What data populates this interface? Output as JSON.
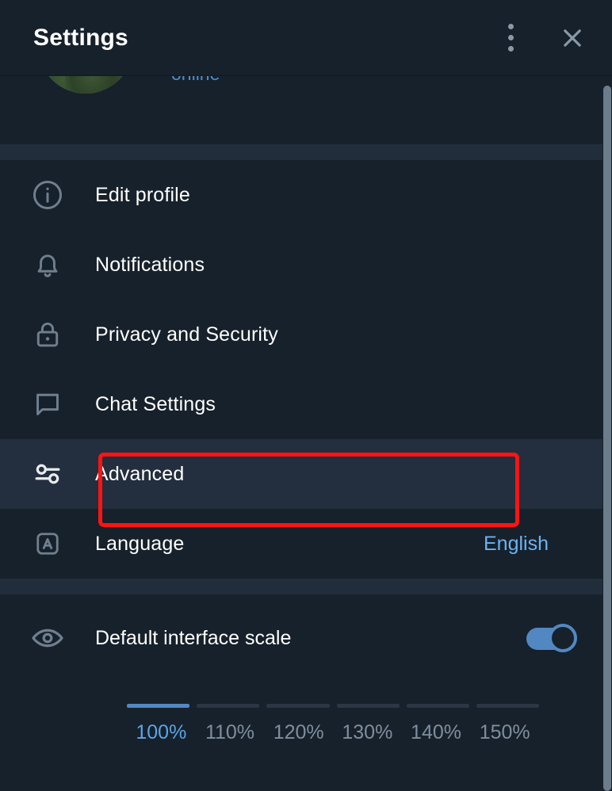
{
  "window": {
    "title": "Settings",
    "menu_icon": "more-vertical-icon",
    "close_icon": "close-icon"
  },
  "colors": {
    "background": "#17212b",
    "row_hover": "#232e3e",
    "divider": "#222d3c",
    "accent": "#5288c1",
    "link": "#6ab3f3",
    "highlight_box": "#ff1414",
    "icon": "#707f8f",
    "text": "#ffffff",
    "muted_text": "#7f8e9e"
  },
  "profile": {
    "avatar_icon": "user-avatar-photo",
    "name": "",
    "status": "online"
  },
  "menu": {
    "items": [
      {
        "label": "Edit profile",
        "icon": "info-circle-icon",
        "value": "",
        "hover": false
      },
      {
        "label": "Notifications",
        "icon": "bell-icon",
        "value": "",
        "hover": false
      },
      {
        "label": "Privacy and Security",
        "icon": "lock-icon",
        "value": "",
        "hover": false
      },
      {
        "label": "Chat Settings",
        "icon": "chat-bubble-icon",
        "value": "",
        "hover": false
      },
      {
        "label": "Advanced",
        "icon": "sliders-icon",
        "value": "",
        "hover": true
      },
      {
        "label": "Language",
        "icon": "language-a-icon",
        "value": "English",
        "hover": false
      }
    ]
  },
  "interface_scale": {
    "icon": "eye-icon",
    "title": "Default interface scale",
    "toggle_on": true,
    "selected_index": 0,
    "steps": [
      "100%",
      "110%",
      "120%",
      "130%",
      "140%",
      "150%"
    ]
  },
  "annotation": {
    "target": "Advanced",
    "shape": "rectangle"
  },
  "scrollbar": {
    "visible": true
  }
}
